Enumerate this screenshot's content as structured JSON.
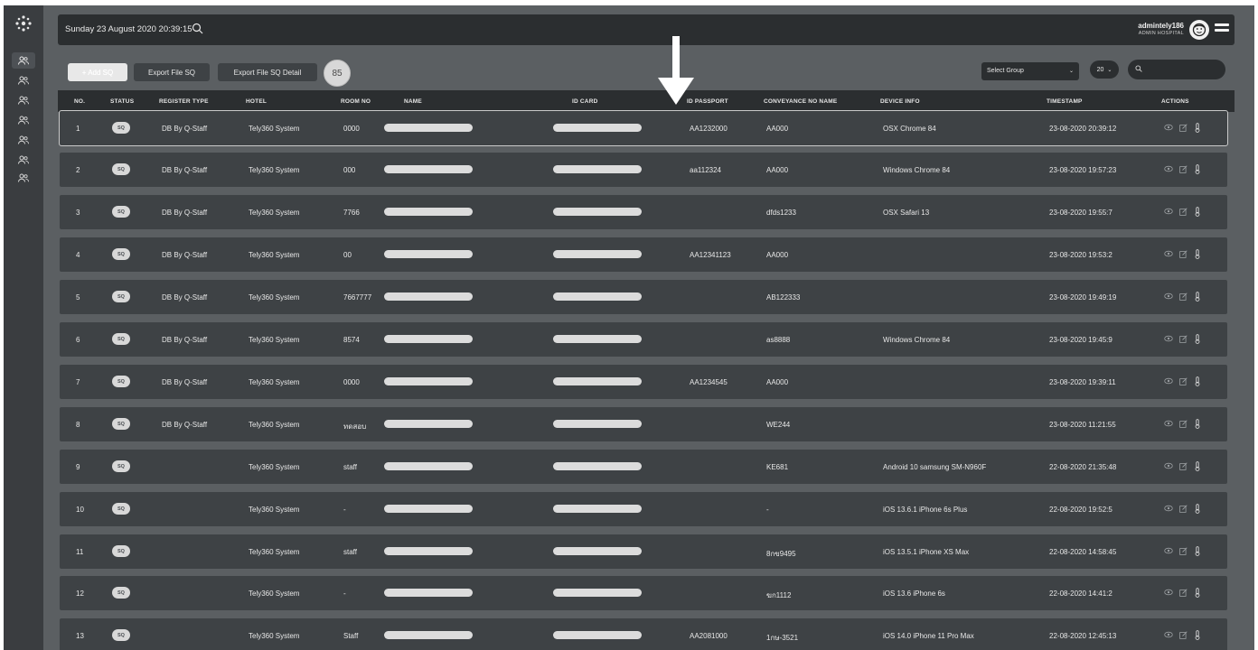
{
  "header": {
    "datetime": "Sunday 23 August 2020 20:39:15",
    "user_name": "admintely186",
    "user_role": "ADMIN HOSPITAL"
  },
  "toolbar": {
    "add_label": "+ Add SQ",
    "export_label": "Export File SQ",
    "export_detail_label": "Export File SQ Detail",
    "count": "85",
    "group_select": "Select Group",
    "page_size": "20",
    "search_placeholder": ""
  },
  "columns": {
    "no": "NO.",
    "status": "STATUS",
    "register_type": "REGISTER TYPE",
    "hotel": "HOTEL",
    "room_no": "ROOM NO",
    "name": "NAME",
    "id_card": "ID CARD",
    "id_passport": "ID PASSPORT",
    "conveyance": "CONVEYANCE NO NAME",
    "device": "DEVICE INFO",
    "timestamp": "TIMESTAMP",
    "actions": "ACTIONS"
  },
  "rows": [
    {
      "no": "1",
      "status": "SQ",
      "register_type": "DB By Q-Staff",
      "hotel": "Tely360 System",
      "room": "0000",
      "passport": "AA1232000",
      "conveyance": "AA000",
      "device": "OSX Chrome 84",
      "timestamp": "23-08-2020 20:39:12"
    },
    {
      "no": "2",
      "status": "SQ",
      "register_type": "DB By Q-Staff",
      "hotel": "Tely360 System",
      "room": "000",
      "passport": "aa112324",
      "conveyance": "AA000",
      "device": "Windows Chrome 84",
      "timestamp": "23-08-2020 19:57:23"
    },
    {
      "no": "3",
      "status": "SQ",
      "register_type": "DB By Q-Staff",
      "hotel": "Tely360 System",
      "room": "7766",
      "passport": "",
      "conveyance": "dfds1233",
      "device": "OSX Safari 13",
      "timestamp": "23-08-2020 19:55:7"
    },
    {
      "no": "4",
      "status": "SQ",
      "register_type": "DB By Q-Staff",
      "hotel": "Tely360 System",
      "room": "00",
      "passport": "AA12341123",
      "conveyance": "AA000",
      "device": "",
      "timestamp": "23-08-2020 19:53:2"
    },
    {
      "no": "5",
      "status": "SQ",
      "register_type": "DB By Q-Staff",
      "hotel": "Tely360 System",
      "room": "7667777",
      "passport": "",
      "conveyance": "AB122333",
      "device": "",
      "timestamp": "23-08-2020 19:49:19"
    },
    {
      "no": "6",
      "status": "SQ",
      "register_type": "DB By Q-Staff",
      "hotel": "Tely360 System",
      "room": "8574",
      "passport": "",
      "conveyance": "as8888",
      "device": "Windows Chrome 84",
      "timestamp": "23-08-2020 19:45:9"
    },
    {
      "no": "7",
      "status": "SQ",
      "register_type": "DB By Q-Staff",
      "hotel": "Tely360 System",
      "room": "0000",
      "passport": "AA1234545",
      "conveyance": "AA000",
      "device": "",
      "timestamp": "23-08-2020 19:39:11"
    },
    {
      "no": "8",
      "status": "SQ",
      "register_type": "DB By Q-Staff",
      "hotel": "Tely360 System",
      "room": "ทดสอบ",
      "passport": "",
      "conveyance": "WE244",
      "device": "",
      "timestamp": "23-08-2020 11:21:55"
    },
    {
      "no": "9",
      "status": "SQ",
      "register_type": "",
      "hotel": "Tely360 System",
      "room": "staff",
      "passport": "",
      "conveyance": "KE681",
      "device": "Android 10 samsung SM-N960F",
      "timestamp": "22-08-2020 21:35:48"
    },
    {
      "no": "10",
      "status": "SQ",
      "register_type": "",
      "hotel": "Tely360 System",
      "room": "-",
      "passport": "",
      "conveyance": "-",
      "device": "iOS 13.6.1 iPhone 6s Plus",
      "timestamp": "22-08-2020 19:52:5"
    },
    {
      "no": "11",
      "status": "SQ",
      "register_type": "",
      "hotel": "Tely360 System",
      "room": "staff",
      "passport": "",
      "conveyance": "8กข9495",
      "device": "iOS 13.5.1 iPhone XS Max",
      "timestamp": "22-08-2020 14:58:45"
    },
    {
      "no": "12",
      "status": "SQ",
      "register_type": "",
      "hotel": "Tely360 System",
      "room": "-",
      "passport": "",
      "conveyance": "ฆก1112",
      "device": "iOS 13.6 iPhone 6s",
      "timestamp": "22-08-2020 14:41:2"
    },
    {
      "no": "13",
      "status": "SQ",
      "register_type": "",
      "hotel": "Tely360 System",
      "room": "Staff",
      "passport": "AA2081000",
      "conveyance": "1กษ-3521",
      "device": "iOS 14.0 iPhone 11 Pro Max",
      "timestamp": "22-08-2020 12:45:13"
    }
  ]
}
